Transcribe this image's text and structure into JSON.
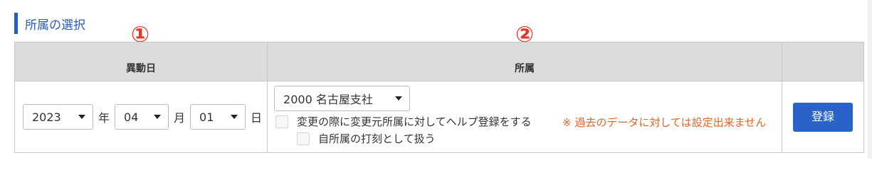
{
  "section": {
    "title": "所属の選択"
  },
  "annotations": {
    "badge_1": "①",
    "badge_2": "②"
  },
  "table": {
    "headers": {
      "date": "異動日",
      "org": "所属",
      "action": ""
    }
  },
  "date": {
    "year": "2023",
    "year_unit": "年",
    "month": "04",
    "month_unit": "月",
    "day": "01",
    "day_unit": "日"
  },
  "org": {
    "selected": "2000 名古屋支社",
    "help_checkbox_label": "変更の際に変更元所属に対してヘルプ登録をする",
    "own_checkbox_label": "自所属の打刻として扱う",
    "note": "※ 過去のデータに対しては設定出来ません"
  },
  "actions": {
    "register_label": "登録"
  },
  "colors": {
    "accent": "#2a5cb8",
    "button": "#2a63c8",
    "note": "#e0662a",
    "badge": "#e5362b",
    "header_bg": "#dcdcdc"
  }
}
